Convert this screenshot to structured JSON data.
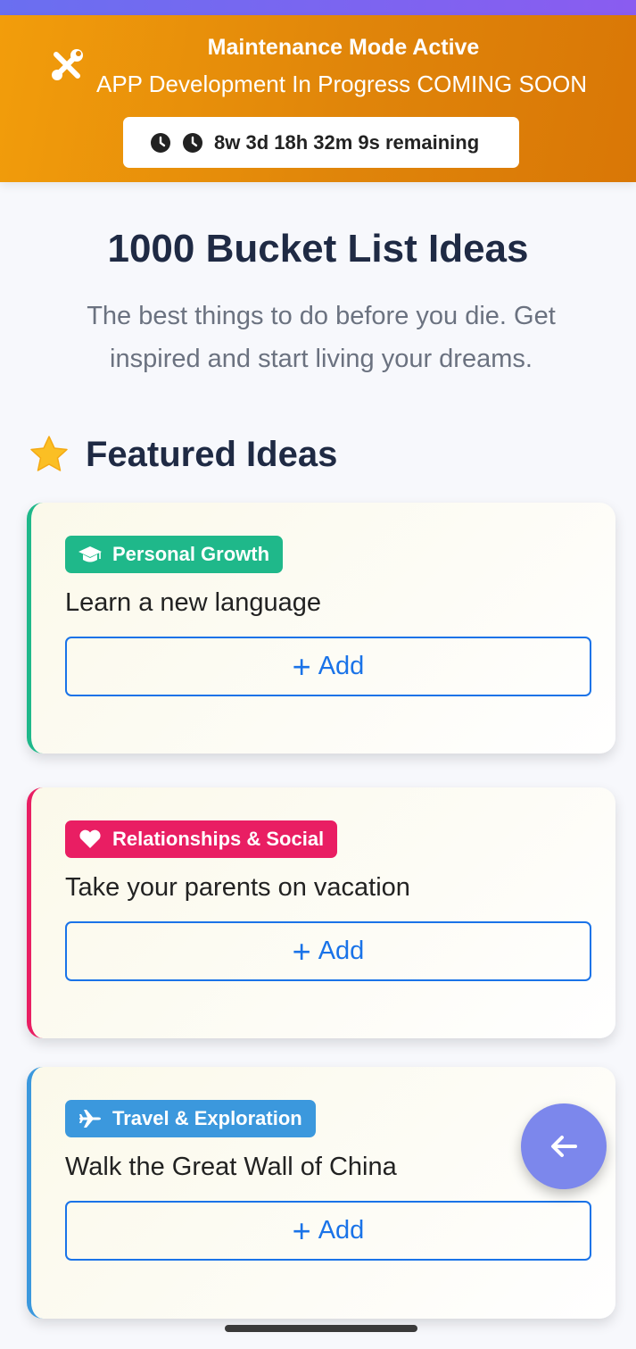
{
  "colors": {
    "banner": "#e58c0b",
    "accent_blue": "#1a73e8",
    "personal_growth": "#1fb88a",
    "relationships": "#e91e63",
    "travel": "#3b98dd",
    "fab": "#7c87ec"
  },
  "banner": {
    "icon": "tools-icon",
    "title": "Maintenance Mode Active",
    "subtitle": "APP Development In Progress COMING SOON",
    "timer": "8w 3d 18h 32m 9s remaining"
  },
  "hero": {
    "title": "1000 Bucket List Ideas",
    "subtitle": "The best things to do before you die. Get inspired and start living your dreams."
  },
  "featured": {
    "title": "Featured Ideas",
    "icon": "star-icon",
    "cards": [
      {
        "category": "Personal Growth",
        "icon": "graduation-cap-icon",
        "idea": "Learn a new language",
        "add_label": "Add"
      },
      {
        "category": "Relationships & Social",
        "icon": "heart-icon",
        "idea": "Take your parents on vacation",
        "add_label": "Add"
      },
      {
        "category": "Travel & Exploration",
        "icon": "plane-icon",
        "idea": "Walk the Great Wall of China",
        "add_label": "Add"
      }
    ]
  },
  "fab": {
    "icon": "arrow-left-icon"
  }
}
